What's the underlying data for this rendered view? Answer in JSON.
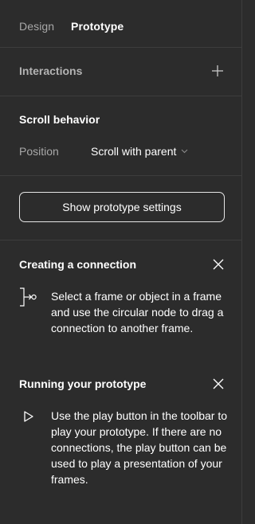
{
  "tabs": {
    "design": "Design",
    "prototype": "Prototype"
  },
  "interactions": {
    "title": "Interactions",
    "add_icon": "plus-icon"
  },
  "scroll_behavior": {
    "title": "Scroll behavior",
    "position_label": "Position",
    "position_value": "Scroll with parent",
    "dropdown_icon": "chevron-down-icon"
  },
  "settings_button": {
    "label": "Show prototype settings"
  },
  "tips": [
    {
      "title": "Creating a connection",
      "icon": "connection-node-icon",
      "text": "Select a frame or object in a frame and use the circular node to drag a connection to another frame."
    },
    {
      "title": "Running your prototype",
      "icon": "play-icon",
      "text": "Use the play button in the toolbar to play your prototype. If there are no connections, the play button can be used to play a presentation of your frames."
    }
  ],
  "colors": {
    "background": "#2c2c2c",
    "divider": "#3d3d3d",
    "text_primary": "#ffffff",
    "text_secondary": "#a8a8a8"
  }
}
